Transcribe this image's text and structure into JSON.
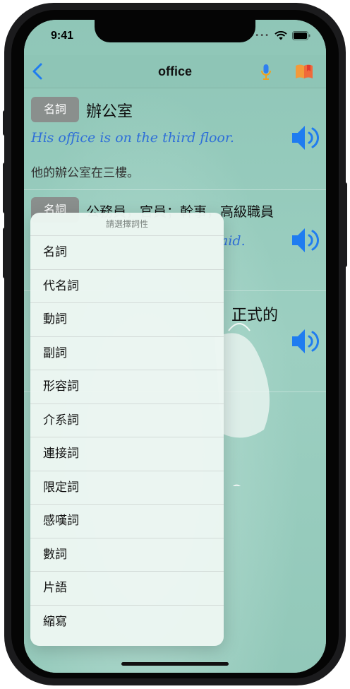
{
  "status_bar": {
    "time": "9:41"
  },
  "nav": {
    "title": "office"
  },
  "entries": [
    {
      "pos": "名詞",
      "meaning": "辦公室",
      "example_en": "His office is on the third floor.",
      "example_zh": "他的辦公室在三樓。"
    },
    {
      "pos": "名詞",
      "meaning": "公務員，官員；幹事，高級職員",
      "example_en_visible": "aid."
    },
    {
      "meaning_visible": "正式的"
    }
  ],
  "popup": {
    "header": "請選擇詞性",
    "items": [
      "名詞",
      "代名詞",
      "動詞",
      "副詞",
      "形容詞",
      "介系詞",
      "連接詞",
      "限定詞",
      "感嘆詞",
      "數詞",
      "片語",
      "縮寫"
    ]
  },
  "colors": {
    "background": "#98cbbd",
    "accent_blue": "#1f7cf0",
    "badge": "#8a8f8d",
    "example_text": "#2f6fd8"
  },
  "icons": [
    "back-chevron-icon",
    "microphone-icon",
    "bookmark-book-icon",
    "speaker-icon",
    "wifi-icon",
    "battery-icon"
  ]
}
